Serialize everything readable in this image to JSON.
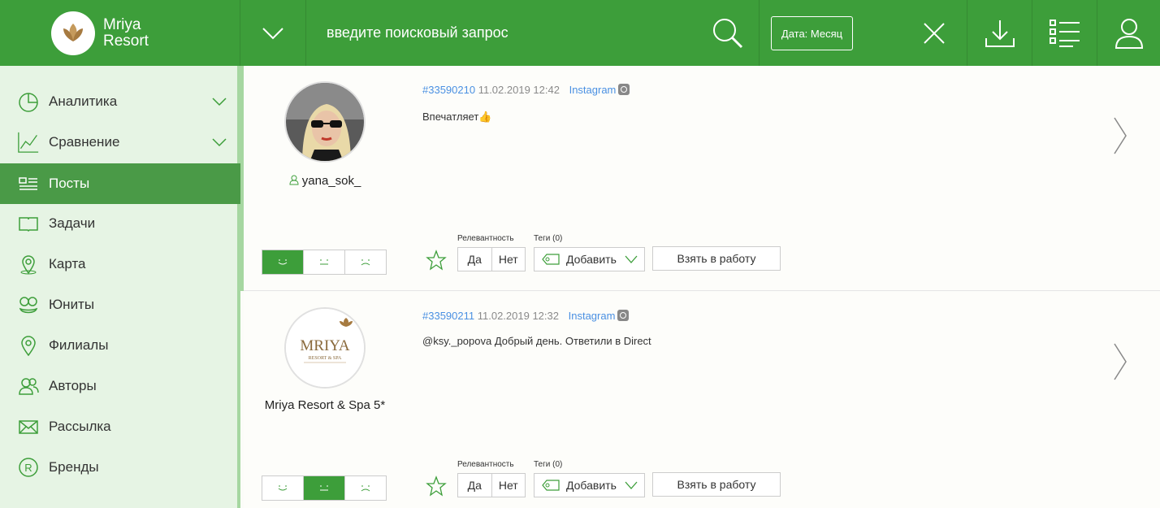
{
  "brand": {
    "line1": "Mriya",
    "line2": "Resort"
  },
  "search": {
    "placeholder": "введите поисковый запрос"
  },
  "date_filter": "Дата: Месяц",
  "sidebar": {
    "items": [
      {
        "label": "Аналитика",
        "icon": "pie-chart-icon",
        "chevron": true
      },
      {
        "label": "Сравнение",
        "icon": "line-chart-icon",
        "chevron": true
      },
      {
        "label": "Посты",
        "icon": "list-icon",
        "active": true
      },
      {
        "label": "Задачи",
        "icon": "book-icon"
      },
      {
        "label": "Карта",
        "icon": "map-pin-icon"
      },
      {
        "label": "Юниты",
        "icon": "units-icon"
      },
      {
        "label": "Филиалы",
        "icon": "location-icon"
      },
      {
        "label": "Авторы",
        "icon": "authors-icon"
      },
      {
        "label": "Рассылка",
        "icon": "mail-icon"
      },
      {
        "label": "Бренды",
        "icon": "registered-icon"
      }
    ]
  },
  "labels": {
    "relevance": "Релевантность",
    "tags": "Теги (0)",
    "yes": "Да",
    "no": "Нет",
    "add": "Добавить",
    "take": "Взять в работу"
  },
  "posts": [
    {
      "id": "#33590210",
      "datetime": "11.02.2019 12:42",
      "source": "Instagram",
      "text": "Впечатляет👍",
      "author": "yana_sok_",
      "sentiment": "positive"
    },
    {
      "id": "#33590211",
      "datetime": "11.02.2019 12:32",
      "source": "Instagram",
      "text": "@ksy._popova Добрый день. Ответили в Direct",
      "author": "Mriya Resort & Spa 5*",
      "avatar_text": "MRIYA",
      "avatar_subtext": "RESORT & SPA",
      "sentiment": "neutral"
    }
  ],
  "colors": {
    "brand_green": "#3d9e3a",
    "sidebar_bg": "#e6f4e4",
    "active_item": "#4a9a47",
    "link_blue": "#4a90e2"
  }
}
